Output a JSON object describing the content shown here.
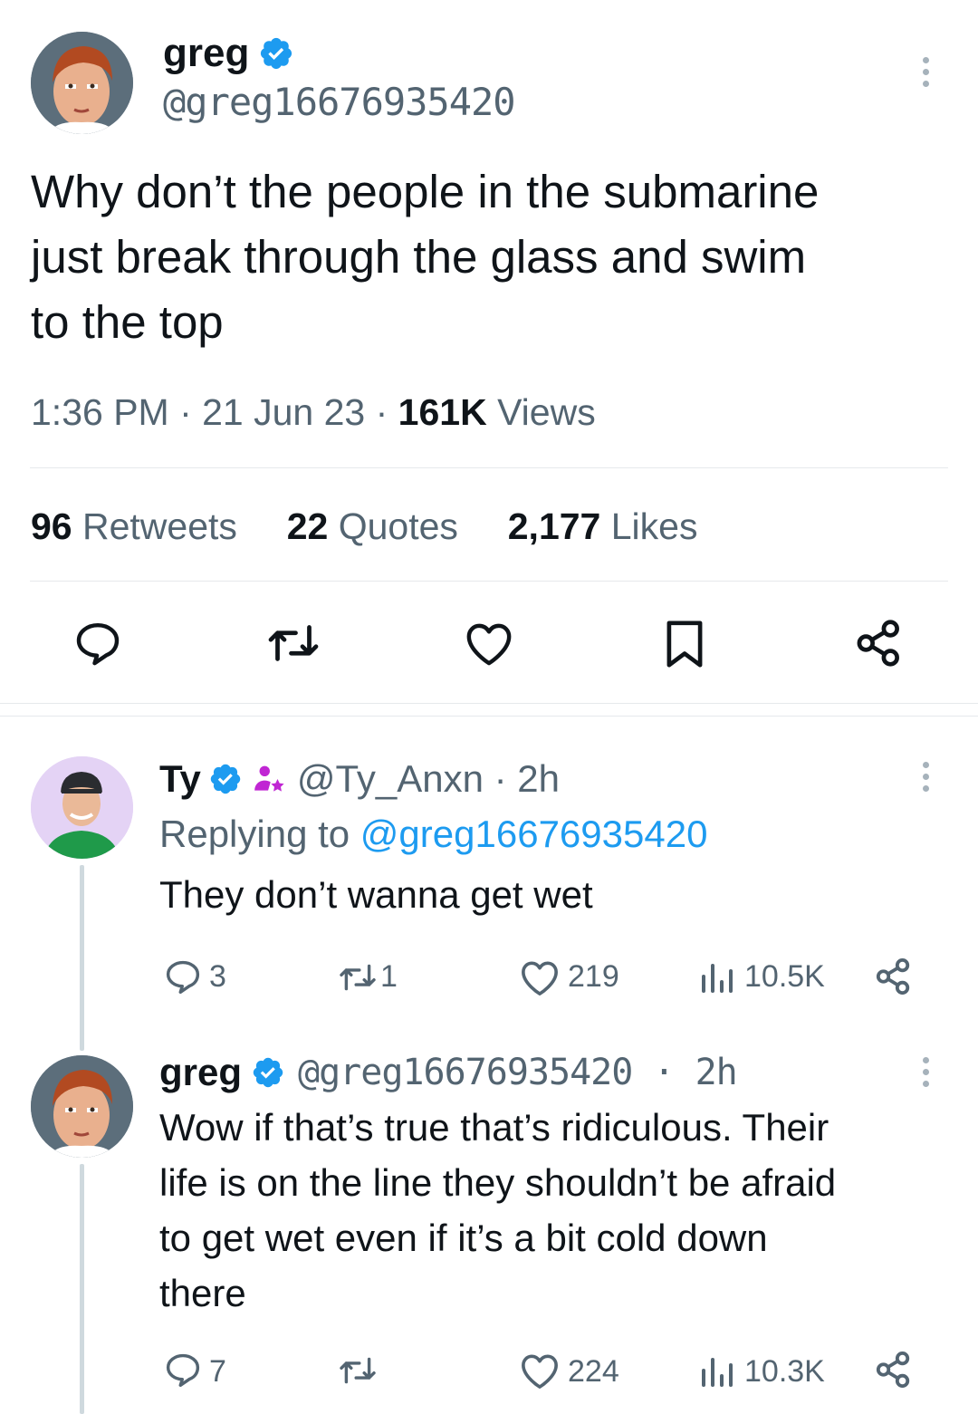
{
  "main_tweet": {
    "display_name": "greg",
    "handle": "@greg16676935420",
    "text_lines": [
      "Why don’t the people in the submarine",
      "just break through the glass and swim",
      "to the top"
    ],
    "time": "1:36 PM · 21 Jun 23 · ",
    "views_count": "161K",
    "views_label": " Views",
    "retweets_count": "96",
    "retweets_label": " Retweets",
    "quotes_count": "22",
    "quotes_label": " Quotes",
    "likes_count": "2,177",
    "likes_label": " Likes"
  },
  "reply1": {
    "display_name": "Ty",
    "handle": "@Ty_Anxn · 2h",
    "replying_prefix": "Replying to ",
    "replying_handle": "@greg16676935420",
    "text": "They don’t wanna get wet",
    "replies": "3",
    "retweets": "1",
    "likes": "219",
    "views": "10.5K"
  },
  "reply2": {
    "display_name": "greg",
    "handle": "@greg16676935420 · 2h",
    "text_lines": [
      "Wow if that’s true that’s ridiculous. Their",
      "life is on the line they shouldn’t be afraid",
      "to get wet even if it’s a bit cold down",
      "there"
    ],
    "replies": "7",
    "retweets": "",
    "likes": "224",
    "views": "10.3K"
  },
  "colors": {
    "verified": "#1d9bf0",
    "link": "#1d9bf0",
    "muted": "#536471",
    "text": "#0f1419",
    "subscriber_badge": "#c026d3"
  },
  "icons": [
    "reply-icon",
    "retweet-icon",
    "like-icon",
    "bookmark-icon",
    "share-icon",
    "views-icon",
    "verified-icon",
    "more-icon"
  ]
}
